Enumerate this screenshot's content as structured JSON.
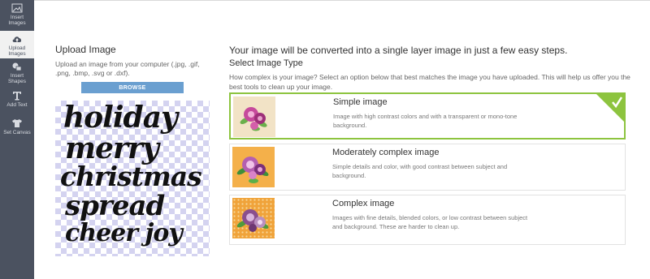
{
  "sidebar": {
    "items": [
      {
        "label1": "Insert",
        "label2": "Images",
        "icon": "image-icon",
        "active": false
      },
      {
        "label1": "Upload",
        "label2": "Images",
        "icon": "cloud-upload-icon",
        "active": true
      },
      {
        "label1": "Insert",
        "label2": "Shapes",
        "icon": "shapes-icon",
        "active": false
      },
      {
        "label1": "Add Text",
        "label2": "",
        "icon": "text-icon",
        "active": false
      },
      {
        "label1": "Set Canvas",
        "label2": "",
        "icon": "shirt-icon",
        "active": false
      }
    ]
  },
  "upload": {
    "title": "Upload Image",
    "description": "Upload an image from your computer (.jpg, .gif, .png, .bmp, .svg or .dxf).",
    "browse_label": "BROWSE",
    "preview_lines": [
      "holiday",
      "merry",
      "christmas",
      "spread",
      "cheer joy"
    ]
  },
  "main": {
    "headline": "Your image will be converted into a single layer image in just a few easy steps.",
    "subheading": "Select Image Type",
    "question": "How complex is your image? Select an option below that best matches the image you have uploaded. This will help us offer you the best tools to clean up your image.",
    "options": [
      {
        "title": "Simple image",
        "description": "Image with high contrast colors and with a transparent or mono-tone background.",
        "selected": true
      },
      {
        "title": "Moderately complex image",
        "description": "Simple details and color, with good contrast between subject and background.",
        "selected": false
      },
      {
        "title": "Complex image",
        "description": "Images with fine details, blended colors, or low contrast between subject and background. These are harder to clean up.",
        "selected": false
      }
    ]
  },
  "colors": {
    "sidebar_bg": "#4b5260",
    "browse_bg": "#6a9fd0",
    "selected_border": "#8dc43f",
    "checker": "#d4d3f0"
  }
}
